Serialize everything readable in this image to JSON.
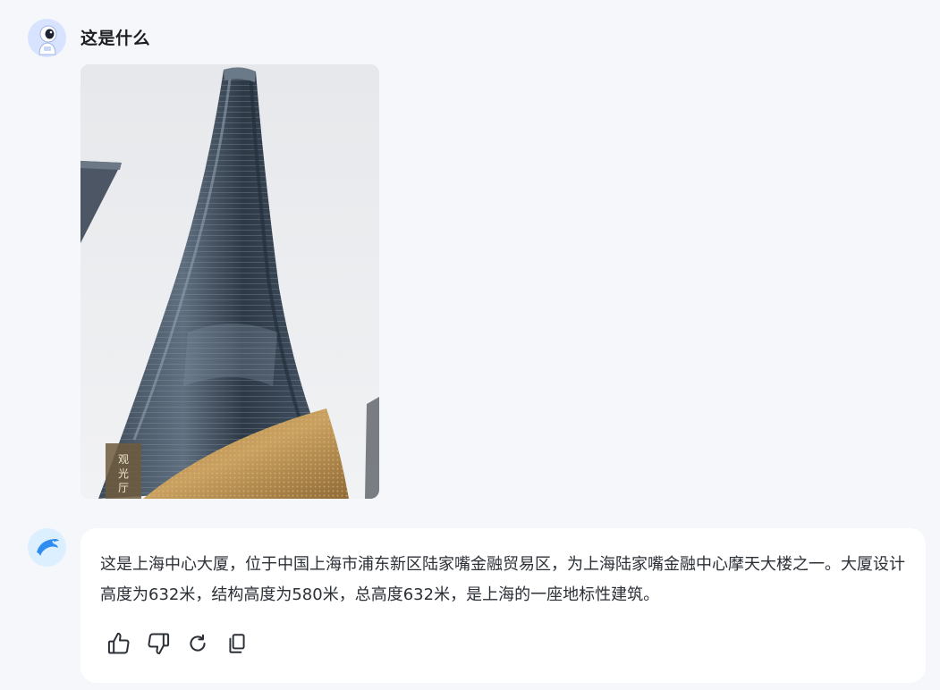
{
  "user_message": {
    "avatar_icon": "astronaut-avatar-icon",
    "text": "这是什么",
    "attachment": "shanghai-tower-photo",
    "watermark": "观 光 厅"
  },
  "assistant_message": {
    "avatar_icon": "dolphin-avatar-icon",
    "text": "这是上海中心大厦，位于中国上海市浦东新区陆家嘴金融贸易区，为上海陆家嘴金融中心摩天大楼之一。大厦设计高度为632米，结构高度为580米，总高度632米，是上海的一座地标性建筑。",
    "actions": [
      {
        "name": "like-button",
        "icon": "thumbs-up-icon"
      },
      {
        "name": "dislike-button",
        "icon": "thumbs-down-icon"
      },
      {
        "name": "regenerate-button",
        "icon": "refresh-icon"
      },
      {
        "name": "copy-button",
        "icon": "copy-icon"
      }
    ]
  },
  "colors": {
    "page_background": "#f5f7fb",
    "bubble_background": "#ffffff",
    "text": "#2b2f36",
    "user_avatar_bg": "#d8e4ff",
    "bot_avatar_bg": "#dcefff",
    "bot_accent": "#2f8cf0"
  }
}
